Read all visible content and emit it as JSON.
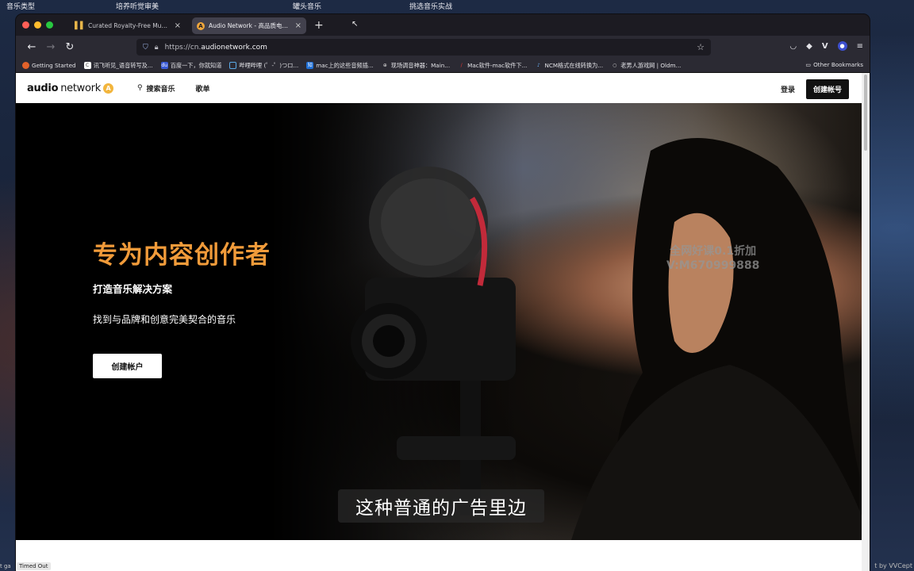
{
  "desktop": {
    "top_labels": [
      "音乐类型",
      "培养听觉审美",
      "罐头音乐",
      "挑选音乐实战"
    ],
    "bottom_left_text": "t ga",
    "status_pill": "Timed Out",
    "bottom_right_text": "t by VVCept"
  },
  "browser": {
    "tabs": [
      {
        "label": "Curated Royalty-Free Music Libr",
        "icon": "bars-icon"
      },
      {
        "label": "Audio Network - 高品质电视、电影",
        "icon": "audio-network-icon"
      }
    ],
    "url_prefix": "https://cn.",
    "url_domain": "audionetwork.com",
    "bookmarks": [
      "Getting Started",
      "讯飞听见_语音转写及...",
      "百度一下，你就知道",
      "哔哩哔哩 (゜-゜)つロ...",
      "mac上的这些音频插...",
      "现场调音神器：Main...",
      "Mac软件-mac软件下...",
      "NCM格式在线转换为...",
      "老男人游戏网 | Oldm..."
    ],
    "other_bookmarks": "Other Bookmarks"
  },
  "site": {
    "logo_strong": "audio",
    "logo_light": "network",
    "nav": {
      "search": "搜索音乐",
      "playlists": "歌单"
    },
    "login": "登录",
    "create_account_header": "创建帐号"
  },
  "hero": {
    "title": "专为内容创作者",
    "subtitle": "打造音乐解决方案",
    "description": "找到与品牌和创意完美契合的音乐",
    "cta": "创建帐户"
  },
  "watermark": {
    "line1": "全网好课0.1折加",
    "line2": "V:M670999888"
  },
  "caption": "这种普通的广告里边",
  "colors": {
    "accent_orange": "#f19b3a",
    "logo_badge": "#f2b53c"
  }
}
